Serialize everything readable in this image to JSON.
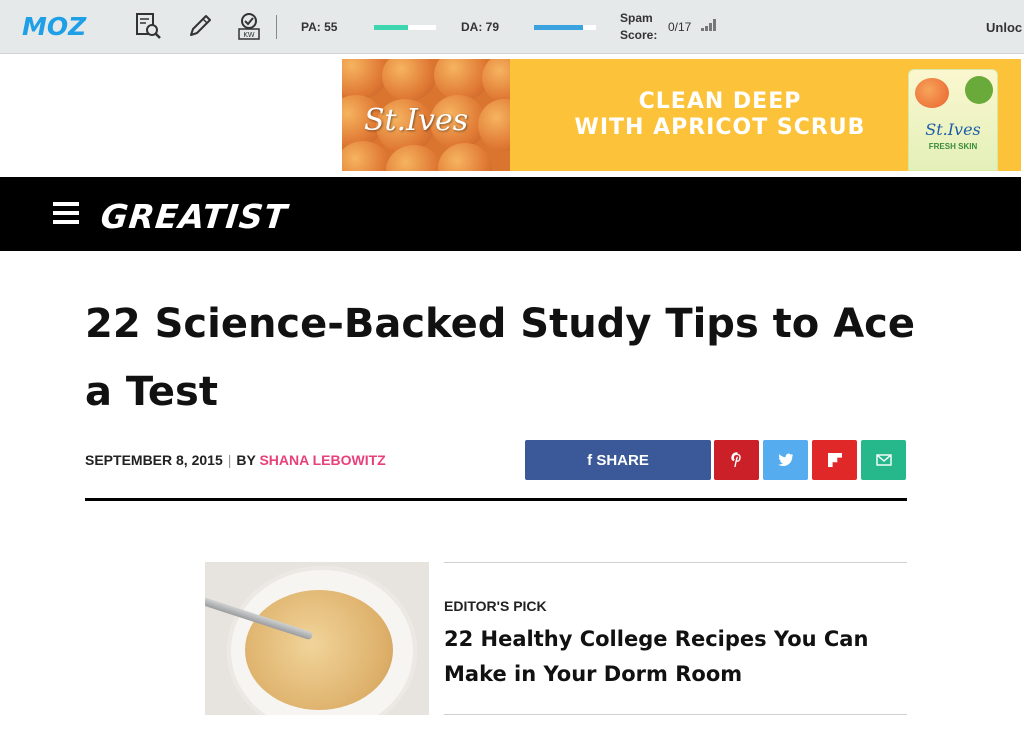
{
  "mozbar": {
    "logo": "MOZ",
    "pa_label": "PA: 55",
    "pa_fill": 0.55,
    "da_label": "DA: 79",
    "da_fill": 0.79,
    "spam_label_line1": "Spam",
    "spam_label_line2": "Score:",
    "spam_value": "0/17",
    "unlock": "Unloc",
    "colors": {
      "logo": "#1f9fe6",
      "pa": "#3dd6b0",
      "da": "#3aa2df"
    }
  },
  "ad": {
    "brand": "St.Ives",
    "headline_line1": "CLEAN DEEP",
    "headline_line2": "WITH APRICOT SCRUB",
    "tube_brand": "St.Ives",
    "tube_sub": "FRESH SKIN"
  },
  "nav": {
    "logo": "GREATIST"
  },
  "article": {
    "title": "22 Science-Backed Study Tips to Ace a Test",
    "date": "SEPTEMBER 8, 2015",
    "by": "BY",
    "author": "SHANA LEBOWITZ"
  },
  "share": {
    "facebook_label": "f SHARE",
    "colors": {
      "facebook": "#3b5998",
      "pinterest": "#cb2027",
      "twitter": "#55acee",
      "flipboard": "#e12828",
      "email": "#26b88b"
    }
  },
  "editors_pick": {
    "kicker": "EDITOR'S PICK",
    "title": "22 Healthy College Recipes You Can Make in Your Dorm Room"
  }
}
